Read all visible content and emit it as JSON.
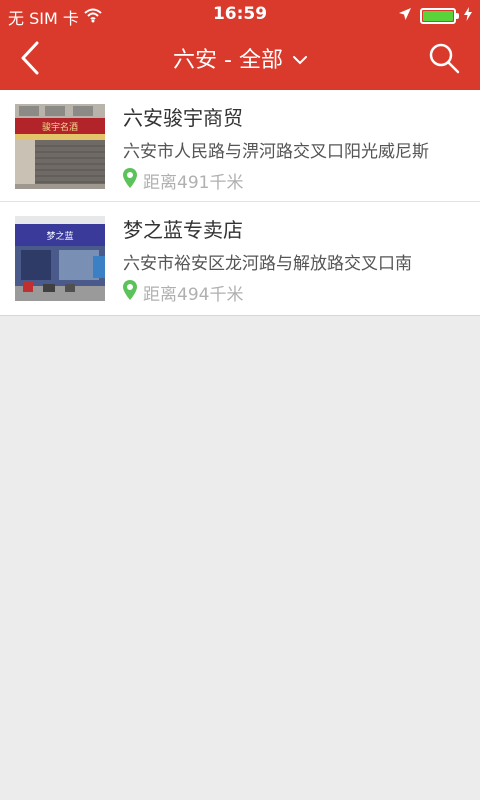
{
  "status": {
    "carrier": "无 SIM 卡",
    "time": "16:59",
    "battery_level": 1.0,
    "icons": [
      "wifi-icon",
      "location-arrow-icon",
      "battery-icon",
      "charging-icon"
    ]
  },
  "nav": {
    "title": "六安 - 全部",
    "icons": [
      "back-icon",
      "chevron-down-icon",
      "search-icon"
    ]
  },
  "colors": {
    "header": "#d93a2b",
    "location_pin": "#5cc35a",
    "background": "#ececec"
  },
  "stores": [
    {
      "name": "六安骏宇商贸",
      "address": "六安市人民路与淠河路交叉口阳光威尼斯",
      "distance": "距离491千米",
      "thumb_sign": "骏宇名酒"
    },
    {
      "name": "梦之蓝专卖店",
      "address": "六安市裕安区龙河路与解放路交叉口南",
      "distance": "距离494千米",
      "thumb_sign": "梦之蓝"
    }
  ]
}
